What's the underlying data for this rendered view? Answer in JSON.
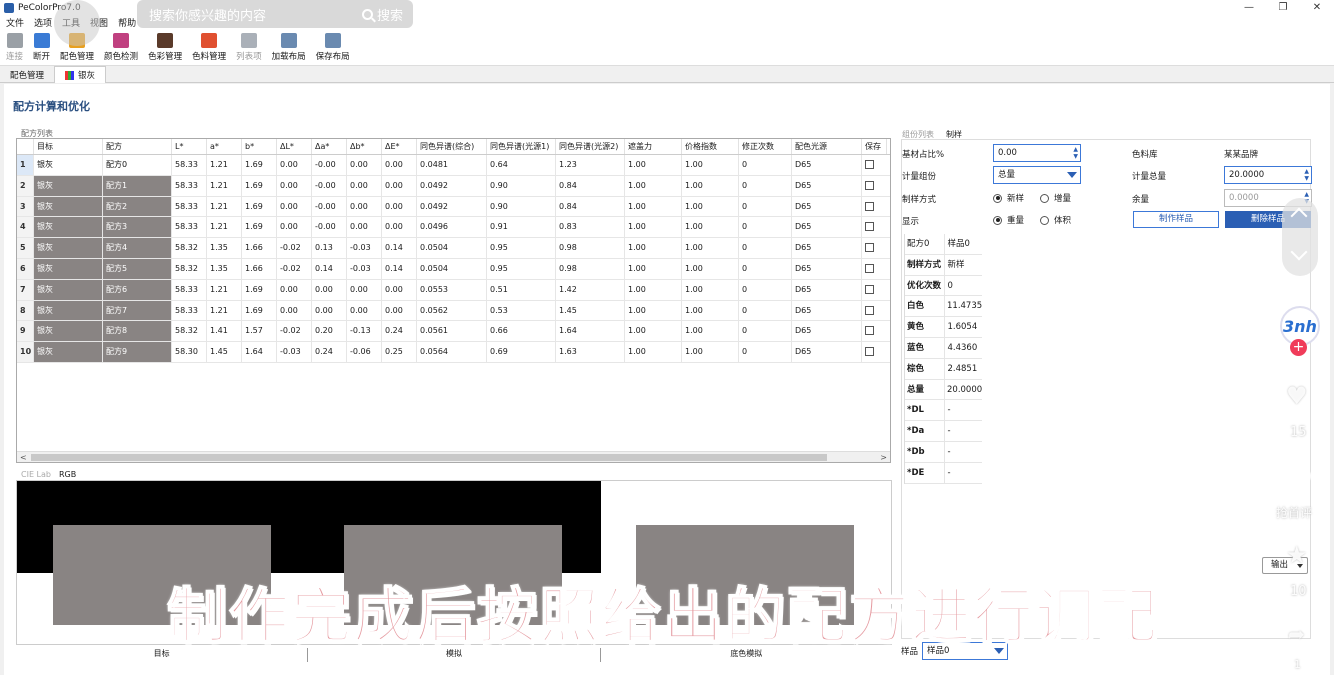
{
  "window": {
    "title": "PeColorPro7.0",
    "controls": [
      "—",
      "❐",
      "✕"
    ]
  },
  "menu": [
    "文件",
    "选项",
    "工具",
    "视图",
    "帮助"
  ],
  "search": {
    "placeholder": "搜索你感兴趣的内容",
    "button": "搜索"
  },
  "toolbar": [
    {
      "label": "连接",
      "icon": "feather-icon",
      "color": "#9aa0a6",
      "disabled": true
    },
    {
      "label": "断开",
      "icon": "plug-icon",
      "color": "#3a7bd5",
      "disabled": false
    },
    {
      "label": "配色管理",
      "icon": "color-wheel-icon",
      "color": "#e8a020",
      "disabled": false
    },
    {
      "label": "颜色检测",
      "icon": "chart-icon",
      "color": "#c04080",
      "disabled": false
    },
    {
      "label": "色彩管理",
      "icon": "palette-icon",
      "color": "#5a3a2a",
      "disabled": false
    },
    {
      "label": "色料管理",
      "icon": "paint-icon",
      "color": "#e05030",
      "disabled": false
    },
    {
      "label": "列表项",
      "icon": "list-icon",
      "color": "#aab0b8",
      "disabled": true
    },
    {
      "label": "加载布局",
      "icon": "layout-load-icon",
      "color": "#6a8ab0",
      "disabled": false
    },
    {
      "label": "保存布局",
      "icon": "layout-save-icon",
      "color": "#6a8ab0",
      "disabled": false
    }
  ],
  "doc_tabs": [
    {
      "label": "配色管理",
      "active": false
    },
    {
      "label": "银灰",
      "active": true
    }
  ],
  "section_title": "配方计算和优化",
  "formula_list": {
    "label": "配方列表",
    "columns": [
      "",
      "目标",
      "配方",
      "L*",
      "a*",
      "b*",
      "ΔL*",
      "Δa*",
      "Δb*",
      "ΔE*",
      "同色异谱(综合)",
      "同色异谱(光源1)",
      "同色异谱(光源2)",
      "遮盖力",
      "价格指数",
      "修正次数",
      "配色光源",
      "保存"
    ],
    "rows": [
      [
        "1",
        "银灰",
        "配方0",
        "58.33",
        "1.21",
        "1.69",
        "0.00",
        "-0.00",
        "0.00",
        "0.00",
        "0.0481",
        "0.64",
        "1.23",
        "1.00",
        "1.00",
        "0",
        "D65"
      ],
      [
        "2",
        "银灰",
        "配方1",
        "58.33",
        "1.21",
        "1.69",
        "0.00",
        "-0.00",
        "0.00",
        "0.00",
        "0.0492",
        "0.90",
        "0.84",
        "1.00",
        "1.00",
        "0",
        "D65"
      ],
      [
        "3",
        "银灰",
        "配方2",
        "58.33",
        "1.21",
        "1.69",
        "0.00",
        "-0.00",
        "0.00",
        "0.00",
        "0.0492",
        "0.90",
        "0.84",
        "1.00",
        "1.00",
        "0",
        "D65"
      ],
      [
        "4",
        "银灰",
        "配方3",
        "58.33",
        "1.21",
        "1.69",
        "0.00",
        "-0.00",
        "0.00",
        "0.00",
        "0.0496",
        "0.91",
        "0.83",
        "1.00",
        "1.00",
        "0",
        "D65"
      ],
      [
        "5",
        "银灰",
        "配方4",
        "58.32",
        "1.35",
        "1.66",
        "-0.02",
        "0.13",
        "-0.03",
        "0.14",
        "0.0504",
        "0.95",
        "0.98",
        "1.00",
        "1.00",
        "0",
        "D65"
      ],
      [
        "6",
        "银灰",
        "配方5",
        "58.32",
        "1.35",
        "1.66",
        "-0.02",
        "0.14",
        "-0.03",
        "0.14",
        "0.0504",
        "0.95",
        "0.98",
        "1.00",
        "1.00",
        "0",
        "D65"
      ],
      [
        "7",
        "银灰",
        "配方6",
        "58.33",
        "1.21",
        "1.69",
        "0.00",
        "0.00",
        "0.00",
        "0.00",
        "0.0553",
        "0.51",
        "1.42",
        "1.00",
        "1.00",
        "0",
        "D65"
      ],
      [
        "8",
        "银灰",
        "配方7",
        "58.33",
        "1.21",
        "1.69",
        "0.00",
        "0.00",
        "0.00",
        "0.00",
        "0.0562",
        "0.53",
        "1.45",
        "1.00",
        "1.00",
        "0",
        "D65"
      ],
      [
        "9",
        "银灰",
        "配方8",
        "58.32",
        "1.41",
        "1.57",
        "-0.02",
        "0.20",
        "-0.13",
        "0.24",
        "0.0561",
        "0.66",
        "1.64",
        "1.00",
        "1.00",
        "0",
        "D65"
      ],
      [
        "10",
        "银灰",
        "配方9",
        "58.30",
        "1.45",
        "1.64",
        "-0.03",
        "0.24",
        "-0.06",
        "0.25",
        "0.0564",
        "0.69",
        "1.63",
        "1.00",
        "1.00",
        "0",
        "D65"
      ]
    ]
  },
  "preview": {
    "tabs": [
      "CIE Lab",
      "RGB"
    ],
    "labels": [
      "目标",
      "模拟",
      "底色模拟"
    ],
    "swatch_color": "#898483"
  },
  "right_panel": {
    "tabs": [
      "组份列表",
      "制样"
    ],
    "base_ratio_label": "基材占比%",
    "base_ratio_value": "0.00",
    "colorant_lib_label": "色料库",
    "colorant_lib_value": "某某品牌",
    "measure_label": "计量组份",
    "measure_value": "总量",
    "total_label": "计量总量",
    "total_value": "20.0000",
    "method_label": "制样方式",
    "method_new": "新样",
    "method_add": "增量",
    "remain_label": "余量",
    "remain_value": "0.0000",
    "display_label": "显示",
    "display_weight": "重量",
    "display_volume": "体积",
    "make_button": "制作样品",
    "delete_button": "删除样品"
  },
  "sample_table": [
    [
      "配方0",
      "样品0"
    ],
    [
      "制样方式",
      "新样"
    ],
    [
      "优化次数",
      "0"
    ],
    [
      "白色",
      "11.4735"
    ],
    [
      "黄色",
      "1.6054"
    ],
    [
      "蓝色",
      "4.4360"
    ],
    [
      "棕色",
      "2.4851"
    ],
    [
      "总量",
      "20.0000"
    ],
    [
      "*DL",
      "-"
    ],
    [
      "*Da",
      "-"
    ],
    [
      "*Db",
      "-"
    ],
    [
      "*DE",
      "-"
    ]
  ],
  "bottom": {
    "sample_label": "样品",
    "sample_value": "样品0",
    "export_label": "输出"
  },
  "overlay": {
    "brand": "3nh",
    "likes": "15",
    "comment_label": "抢首评",
    "favs": "10",
    "shares": "1"
  },
  "caption": "制作完成后按照给出的配方进行调配"
}
